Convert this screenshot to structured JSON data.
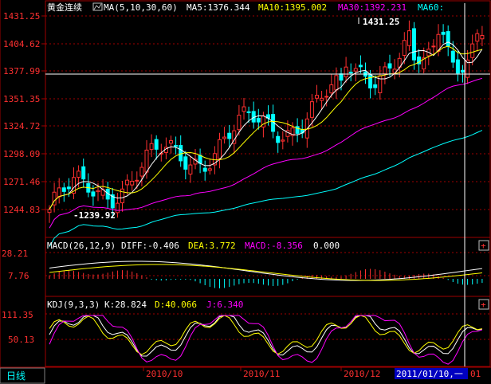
{
  "header": {
    "symbol": "黄金连续",
    "ma_params": "MA(5,10,30,60)",
    "ma5": "MA5:1376.344",
    "ma10": "MA10:1395.002",
    "ma30": "MA30:1392.231",
    "ma60": "MA60:"
  },
  "macd_header": {
    "params": "MACD(26,12,9)",
    "diff": "DIFF:-0.406",
    "dea": "DEA:3.772",
    "macd": "MACD:-8.356",
    "extra": "0.000"
  },
  "kdj_header": {
    "params": "KDJ(9,3,3)",
    "k": "K:28.824",
    "d": "D:40.066",
    "j": "J:6.340"
  },
  "price_axis": [
    "1431.25",
    "1404.62",
    "1377.99",
    "1351.35",
    "1324.72",
    "1298.09",
    "1271.46",
    "1244.83"
  ],
  "macd_axis": [
    "28.21",
    "7.76"
  ],
  "kdj_axis": [
    "111.35",
    "50.13"
  ],
  "annotations": {
    "high": "1431.25",
    "low": "-1239.92"
  },
  "date_axis": [
    "2010/10",
    "2010/11",
    "2010/12"
  ],
  "period_label": "日线",
  "cursor_date": "2011/01/10,一",
  "cursor_tail": "01",
  "scroll_button": "+",
  "colors": {
    "up": "#ff3030",
    "down": "#00ffff",
    "ma5": "#ffffff",
    "ma10": "#ffff00",
    "ma30": "#ff00ff",
    "ma60": "#00ffff",
    "grid": "#a00000",
    "axis_text": "#ff3030"
  },
  "chart_data": {
    "type": "candlestick",
    "price_range": [
      1225,
      1440
    ],
    "high_value": 1431.25,
    "low_value": 1239.92,
    "x_labels": [
      "2010/10",
      "2010/11",
      "2010/12"
    ]
  }
}
